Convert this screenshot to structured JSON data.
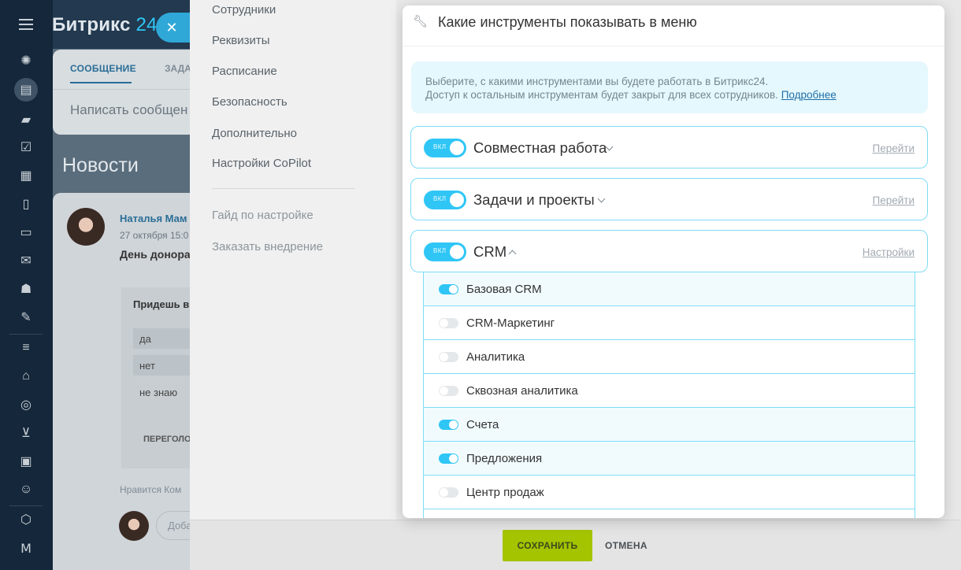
{
  "app": {
    "logo": "Битрикс",
    "logo_num": "24"
  },
  "rail_icons": [
    "menu-icon",
    "weather-icon",
    "feed-icon",
    "chat-icon",
    "tasks-icon",
    "calendar-icon",
    "docs-icon",
    "drive-icon",
    "mail-icon",
    "groups-icon",
    "sign-icon",
    "crm-icon",
    "store-icon",
    "marketing-icon",
    "shop-icon",
    "sites-icon",
    "robots-icon",
    "apps-icon",
    "market-icon"
  ],
  "feed": {
    "tab_message": "СООБЩЕНИЕ",
    "tab_task": "ЗАДА",
    "compose_placeholder": "Написать сообщен",
    "news_title": "Новости",
    "post": {
      "author": "Наталья Мам",
      "date": "27 октября 15:0",
      "headline": "День донора",
      "poll_question": "Придешь в",
      "options": [
        "да",
        "нет",
        "не знаю"
      ],
      "revote": "ПЕРЕГОЛО",
      "footer": "Нравится   Ком",
      "comment_placeholder": "Доба"
    }
  },
  "settings_nav": {
    "items": [
      "Сотрудники",
      "Реквизиты",
      "Расписание",
      "Безопасность",
      "Дополнительно",
      "Настройки CoPilot"
    ],
    "extra": [
      "Гайд по настройке",
      "Заказать внедрение"
    ]
  },
  "modal": {
    "title": "Какие инструменты показывать в меню",
    "info_line1": "Выберите, с какими инструментами вы будете работать в Битрикс24.",
    "info_line2": "Доступ к остальным инструментам будет закрыт для всех сотрудников.",
    "info_more": "Подробнее",
    "toggle_label": "ВКЛ",
    "groups": [
      {
        "name": "Совместная работа",
        "enabled": true,
        "expanded": false,
        "link": "Перейти"
      },
      {
        "name": "Задачи и проекты",
        "enabled": true,
        "expanded": false,
        "link": "Перейти"
      },
      {
        "name": "CRM",
        "enabled": true,
        "expanded": true,
        "link": "Настройки"
      }
    ],
    "crm_items": [
      {
        "name": "Базовая CRM",
        "enabled": true
      },
      {
        "name": "CRM-Маркетинг",
        "enabled": false
      },
      {
        "name": "Аналитика",
        "enabled": false
      },
      {
        "name": "Сквозная аналитика",
        "enabled": false
      },
      {
        "name": "Счета",
        "enabled": true
      },
      {
        "name": "Предложения",
        "enabled": true
      },
      {
        "name": "Центр продаж",
        "enabled": false
      }
    ]
  },
  "footer": {
    "save": "СОХРАНИТЬ",
    "cancel": "ОТМЕНА"
  },
  "colors": {
    "accent": "#2fc6f6",
    "save_button": "#a4c400",
    "rail": "#15273a"
  }
}
